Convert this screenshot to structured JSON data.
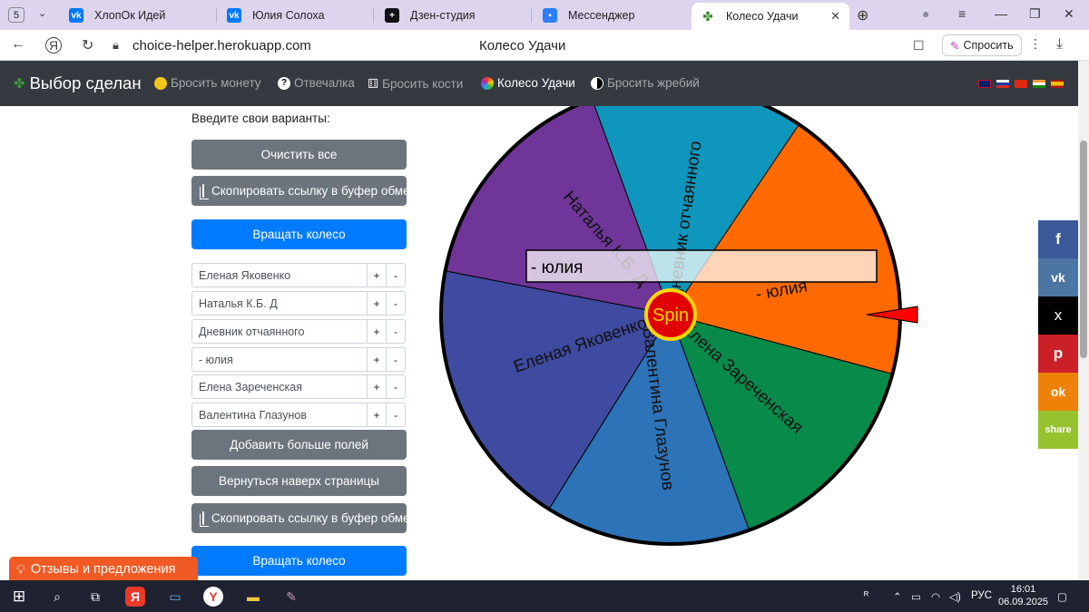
{
  "browser": {
    "tab_count": "5",
    "tabs": [
      {
        "label": "ХлопОк Идей",
        "icon": "vk-icon"
      },
      {
        "label": "Юлия Солоха",
        "icon": "vk-icon"
      },
      {
        "label": "Дзен-студия",
        "icon": "dzen-icon"
      },
      {
        "label": "Мессенджер",
        "icon": "messenger-icon"
      },
      {
        "label": "Колесо Удачи",
        "icon": "clover-icon"
      }
    ],
    "url": "choice-helper.herokuapp.com",
    "page_title": "Колесо Удачи",
    "ask_label": "Спросить"
  },
  "nav": {
    "brand": "Выбор сделан",
    "items": [
      {
        "label": "Бросить монету"
      },
      {
        "label": "Отвечалка"
      },
      {
        "label": "Бросить кости"
      },
      {
        "label": "Колесо Удачи",
        "active": true
      },
      {
        "label": "Бросить жребий"
      }
    ]
  },
  "controls": {
    "intro": "Введите свои варианты:",
    "clear_all": "Очистить все",
    "copy_link": "Скопировать ссылку в буфер обмена",
    "spin_wheel": "Вращать колесо",
    "add_fields": "Добавить больше полей",
    "back_to_top": "Вернуться наверх страницы",
    "plus": "+",
    "minus": "-",
    "entries": [
      "Еленая Яковенко",
      "Наталья К.Б. Д",
      "Дневник отчаянного",
      "- юлия",
      "Елена Зареченская",
      "Валентина Глазунов"
    ]
  },
  "wheel": {
    "center_label": "Spin",
    "winner_label": "- юлия",
    "segments": [
      {
        "label": "Еленая Яковенко",
        "color": "#3e4ba0"
      },
      {
        "label": "Наталья К.Б. Д",
        "color": "#6f3598"
      },
      {
        "label": "Дневник отчаянного",
        "color": "#0f96bc"
      },
      {
        "label": "- юлия",
        "color": "#ff6a00"
      },
      {
        "label": "Елена Зареченская",
        "color": "#078a4a"
      },
      {
        "label": "Валентина Глазунов",
        "color": "#2d73b8"
      }
    ]
  },
  "share": [
    "f",
    "vk",
    "x",
    "p",
    "ok",
    "share"
  ],
  "feedback": "Отзывы и предложения",
  "taskbar": {
    "lang": "РУС",
    "time": "16:01",
    "date": "06.09.2025"
  }
}
